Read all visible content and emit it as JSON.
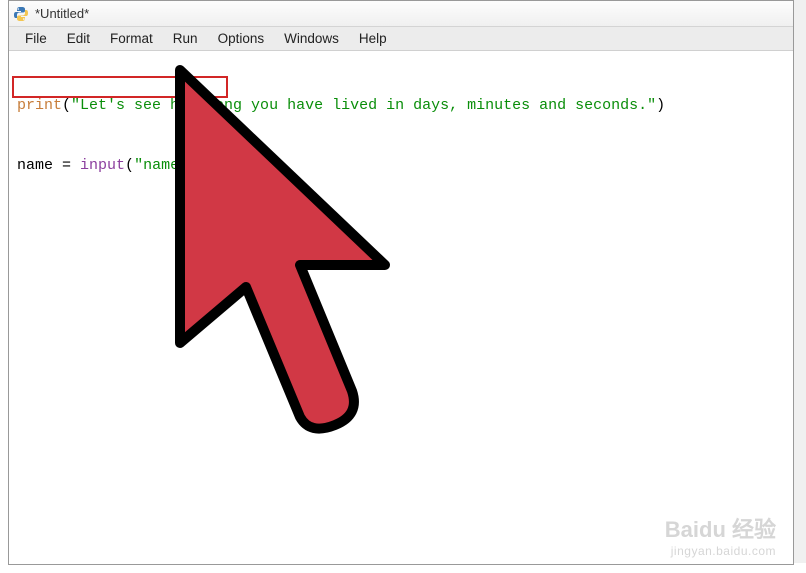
{
  "window": {
    "title": "*Untitled*"
  },
  "menu": {
    "items": [
      "File",
      "Edit",
      "Format",
      "Run",
      "Options",
      "Windows",
      "Help"
    ]
  },
  "code": {
    "line1": {
      "func": "print",
      "open": "(",
      "str": "\"Let's see how long you have lived in days, minutes and seconds.\"",
      "close": ")"
    },
    "line2": {
      "var": "name",
      "eq": " = ",
      "func": "input",
      "open": "(",
      "str": "\"name: \"",
      "close": ")"
    }
  },
  "watermark": {
    "main": "Baidu 经验",
    "sub": "jingyan.baidu.com"
  },
  "colors": {
    "highlight": "#d22626",
    "cursor_fill": "#d13845",
    "cursor_stroke": "#000000"
  }
}
